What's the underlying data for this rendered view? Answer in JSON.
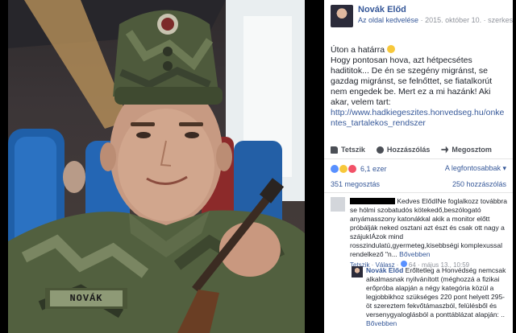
{
  "post": {
    "author": "Novák Előd",
    "like_page": "Az oldal kedvelése",
    "date": "2015. október 10.",
    "edited": "szerkesztve",
    "text_lines": [
      "Úton a határra",
      "Hogy pontosan hova, azt hétpecsétes hadititok... De én se szegény migránst, se gazdag migránst, se felnőttet, se fiatalkorút nem engedek be. Mert ez a mi hazánk! Aki akar, velem tart:"
    ],
    "link": "http://www.hadkiegeszites.honvedseg.hu/onkentes_tartalekos_rendszer",
    "nametape": "NOVÁK"
  },
  "actions": {
    "like": "Tetszik",
    "comment": "Hozzászólás",
    "share": "Megosztom"
  },
  "reactions": {
    "count": "6,1 ezer",
    "sort": "A legfontosabbak"
  },
  "stats": {
    "shares": "351 megosztás",
    "comments": "250 hozzászólás"
  },
  "comment1": {
    "text": "Kedves ElődINe foglalkozz továbbra se hólmi szobatudós kötekedő,beszólogató anyámasszony katonákkal akik a monitor előtt próbálják neked osztani azt észt és csak ott nagy a szájukIÁzok mind rosszindulatú,gyermeteg,kisebbségi komplexussal rendelkező \"n...",
    "more": "Bővebben",
    "like": "Tetszik",
    "reply": "Válasz",
    "likes": "64",
    "time": "május 13., 10:59"
  },
  "reply1": {
    "name": "Novák Előd",
    "text": "Erőltetleg a Honvédség nemcsak alkalmasnak nyilvánított (méghozzá a fizikai erőpróba alapján a négy kategória közül a legjobbikhoz szükséges 220 pont helyett 295-öt szereztem fekvőtámaszból, felülésből és versenygyaloglásból a ponttáblázat alapján:",
    "more": "Bővebben"
  },
  "colors": {
    "link": "#365899",
    "meta": "#90949c"
  }
}
